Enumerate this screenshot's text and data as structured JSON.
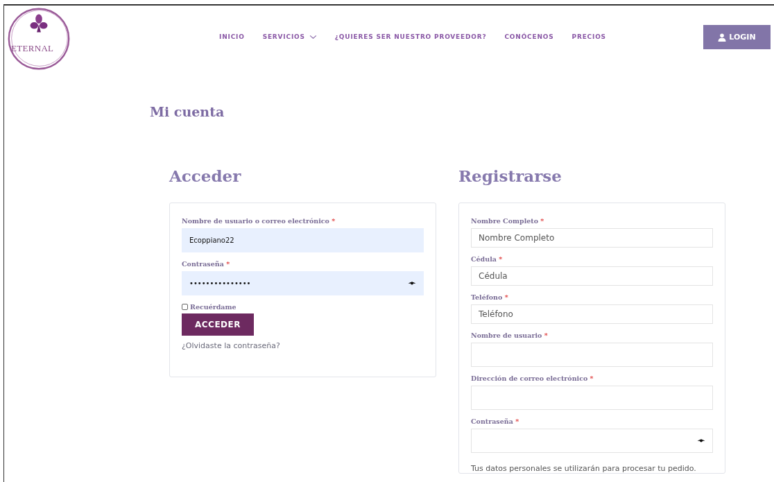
{
  "logo": {
    "text": "ETERNAL"
  },
  "nav": [
    {
      "label": "INICIO",
      "has_menu": false
    },
    {
      "label": "SERVICIOS",
      "has_menu": true
    },
    {
      "label": "¿QUIERES SER NUESTRO PROVEEDOR?",
      "has_menu": false
    },
    {
      "label": "CONÓCENOS",
      "has_menu": false
    },
    {
      "label": "PRECIOS",
      "has_menu": false
    }
  ],
  "login_button": "LOGIN",
  "page_title": "Mi cuenta",
  "login": {
    "title": "Acceder",
    "fields": [
      {
        "label": "Nombre de usuario o correo electrónico",
        "required": "*",
        "kind": "text",
        "value": "Ecoppiano22",
        "autofilled": true
      },
      {
        "label": "Contraseña",
        "required": "*",
        "kind": "password",
        "value": "•••••••••••••••",
        "autofilled": true
      }
    ],
    "remember": {
      "label": "Recuérdame",
      "checked": false
    },
    "submit": "ACCEDER",
    "forgot_link": "¿Olvidaste la contraseña?"
  },
  "register": {
    "title": "Registrarse",
    "fields": [
      {
        "label": "Nombre Completo",
        "required": "*",
        "kind": "text",
        "placeholder": "Nombre Completo",
        "autofilled": false
      },
      {
        "label": "Cédula",
        "required": "*",
        "kind": "text",
        "placeholder": "Cédula",
        "autofilled": false
      },
      {
        "label": "Teléfono",
        "required": "*",
        "kind": "text",
        "placeholder": "Teléfono",
        "autofilled": false
      },
      {
        "label": "Nombre de usuario",
        "required": "*",
        "kind": "tall",
        "autofilled": false
      },
      {
        "label": "Dirección de correo electrónico",
        "required": "*",
        "kind": "tall",
        "autofilled": false
      },
      {
        "label": "Contraseña",
        "required": "*",
        "kind": "password",
        "autofilled": false
      }
    ],
    "privacy_text": "Tus datos personales se utilizarán para procesar tu pedido."
  }
}
